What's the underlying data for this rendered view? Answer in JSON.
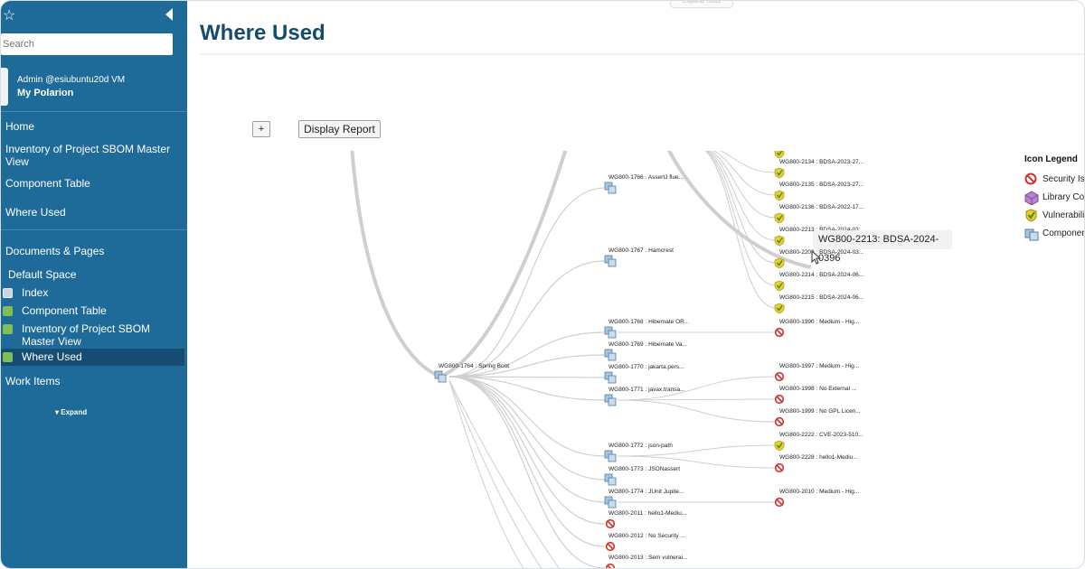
{
  "sidebar": {
    "search_placeholder": "Search",
    "user_name": "Admin @esiubuntu20d VM",
    "user_space": "My Polarion",
    "nav": [
      "Home",
      "Inventory of Project SBOM Master View",
      "Component Table",
      "Where Used"
    ],
    "documents_heading": "Documents & Pages",
    "space_name": "Default Space",
    "space_pages": [
      "Index",
      "Component Table",
      "Inventory of Project SBOM Master View",
      "Where Used"
    ],
    "work_items": "Work Items",
    "expand_label": "▾ Expand"
  },
  "main": {
    "top_tab": "Expand Tools",
    "title": "Where Used",
    "plus_label": "+",
    "report_label": "Display Report"
  },
  "tooltip": "WG800-2213: BDSA-2024-0396",
  "legend": {
    "title": "Icon Legend",
    "items": [
      {
        "icon": "security-issue-icon",
        "label": "Security Issue"
      },
      {
        "icon": "library-component-icon",
        "label": "Library Component"
      },
      {
        "icon": "vulnerability-icon",
        "label": "Vulnerability"
      },
      {
        "icon": "component-icon",
        "label": "Component"
      }
    ]
  },
  "tree": {
    "root": "WG800-1764 : Spring Boot",
    "level1": [
      "WG800-1766 : AssertJ flue...",
      "WG800-1767 : Hamcrest",
      "WG800-1768 : Hibernate OR...",
      "WG800-1769 : Hibernate Va...",
      "WG800-1770 : jakarta.pers...",
      "WG800-1771 : javax.transa...",
      "WG800-1772 : json-path",
      "WG800-1773 : JSONassert",
      "WG800-1774 : JUnit Jupite...",
      "WG800-2011 : hello1-Mediu...",
      "WG800-2012 : No Security ...",
      "WG800-2013 : Sem vulnerai..."
    ],
    "level2": [
      "WG800-2134 : BDSA-2023-27...",
      "WG800-2135 : BDSA-2023-27...",
      "WG800-2136 : BDSA-2022-17...",
      "WG800-2213 : BDSA-2024-03...",
      "WG800-2203 : BDSA-2024-03...",
      "WG800-2214 : BDSA-2024-06...",
      "WG800-2215 : BDSA-2024-06...",
      "WG800-1990 : Medium - Hig...",
      "WG800-1997 : Medium - Hig...",
      "WG800-1998 : No External ...",
      "WG800-1999 : No GPL Licen...",
      "WG800-2222 : CVE-2023-510...",
      "WG800-2228 : hello1-Mediu...",
      "WG800-2010 : Medium - Hig..."
    ]
  },
  "colors": {
    "sidebar_bg": "#1e6b9a",
    "sidebar_active": "#164e73",
    "title": "#154b6e",
    "link": "#cfcfcf",
    "security": "#d0312d",
    "vulnerability": "#e6cf2e"
  }
}
